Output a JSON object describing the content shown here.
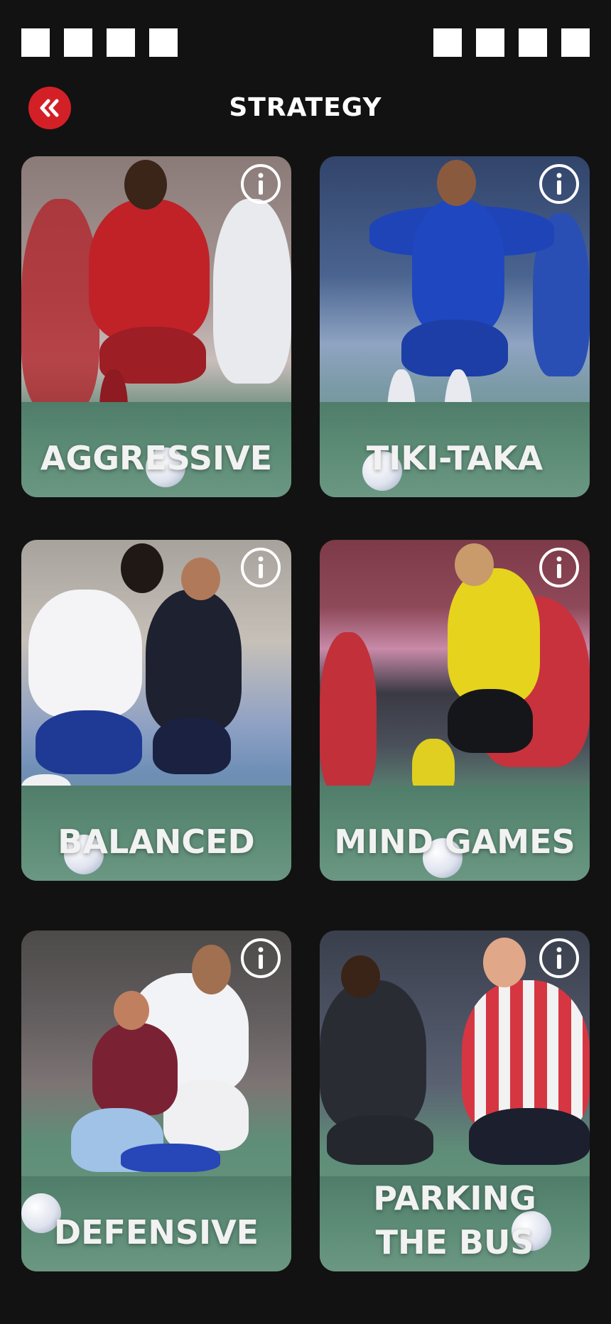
{
  "header": {
    "title": "STRATEGY",
    "back_icon": "double-chevron-left-icon",
    "accent_color": "#d32027"
  },
  "status_bar": {
    "left_indicators": 4,
    "right_indicators": 4
  },
  "strategies": [
    {
      "name": "AGGRESSIVE",
      "info_icon": "info-icon"
    },
    {
      "name": "TIKI-TAKA",
      "info_icon": "info-icon"
    },
    {
      "name": "BALANCED",
      "info_icon": "info-icon"
    },
    {
      "name": "MIND GAMES",
      "info_icon": "info-icon"
    },
    {
      "name": "DEFENSIVE",
      "info_icon": "info-icon"
    },
    {
      "name_lines": [
        "PARKING",
        "THE BUS"
      ],
      "info_icon": "info-icon"
    }
  ]
}
